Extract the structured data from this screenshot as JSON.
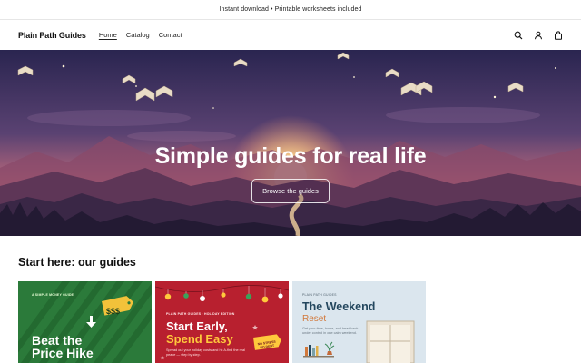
{
  "announcement": "Instant download • Printable worksheets included",
  "header": {
    "brand": "Plain Path Guides",
    "nav": [
      {
        "label": "Home",
        "active": true
      },
      {
        "label": "Catalog",
        "active": false
      },
      {
        "label": "Contact",
        "active": false
      }
    ],
    "icons": [
      "search-icon",
      "account-icon",
      "cart-icon"
    ]
  },
  "hero": {
    "title": "Simple guides for real life",
    "button": "Browse the guides"
  },
  "section": {
    "title": "Start here: our guides"
  },
  "cards": [
    {
      "tag": "A SIMPLE MONEY GUIDE",
      "title_lines": [
        "Beat the",
        "Price Hike"
      ],
      "price_tag": "$$$",
      "colors": {
        "bg": "#2b7a3a",
        "stripe": "#236a30",
        "accent": "#f2c23a"
      }
    },
    {
      "tag": "PLAIN PATH GUIDES · HOLIDAY EDITION",
      "title_line1": "Start Early,",
      "title_line2": "Spend Easy",
      "subtitle": "Spread out your holiday costs and hit A-find the real peace — step by step.",
      "badge": "NO STRESS NO DEBT",
      "colors": {
        "bg": "#b8202f",
        "accent": "#ffc93c"
      }
    },
    {
      "tag": "PLAIN PATH GUIDES",
      "title_line1": "The Weekend",
      "title_line2": "Reset",
      "subtitle": "Get your time, home, and head back under control in one calm weekend.",
      "colors": {
        "bg": "#dbe6ee",
        "title": "#24475e",
        "accent": "#d2783a"
      }
    }
  ]
}
